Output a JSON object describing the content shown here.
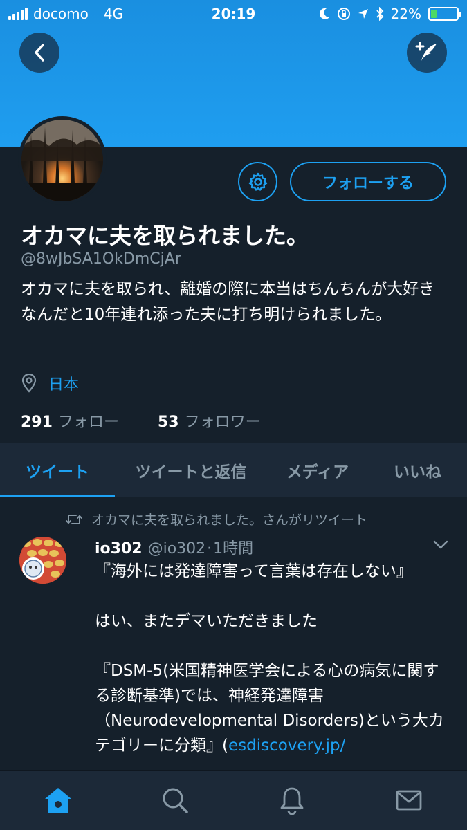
{
  "status_bar": {
    "carrier": "docomo",
    "network": "4G",
    "time": "20:19",
    "battery_percent": "22%",
    "battery_level": 0.22,
    "icons": [
      "moon-icon",
      "rotation-lock-icon",
      "location-arrow-icon",
      "bluetooth-icon",
      "battery-icon"
    ]
  },
  "header": {
    "back_icon": "chevron-left-icon",
    "compose_icon": "compose-tweet-icon",
    "banner_color": "#1da1f2"
  },
  "profile": {
    "display_name": "オカマに夫を取られました。",
    "handle": "@8wJbSA1OkDmCjAr",
    "bio": "オカマに夫を取られ、離婚の際に本当はちんちんが大好きなんだと10年連れ添った夫に打ち明けられました。",
    "location": "日本",
    "following_count": "291",
    "following_label": "フォロー",
    "followers_count": "53",
    "followers_label": "フォロワー",
    "follow_button_label": "フォローする",
    "settings_icon": "gear-icon"
  },
  "tabs": [
    {
      "label": "ツイート",
      "active": true
    },
    {
      "label": "ツイートと返信",
      "active": false
    },
    {
      "label": "メディア",
      "active": false
    },
    {
      "label": "いいね",
      "active": false
    }
  ],
  "tweet": {
    "retweet_text": "オカマに夫を取られました。さんがリツイート",
    "author_name": "io302",
    "author_handle": "@io302",
    "separator": "·",
    "time_ago": "1時間",
    "body_text": "『海外には発達障害って言葉は存在しない』\n\nはい、またデマいただきました\n\n『DSM-5(米国精神医学会による心の病気に関する診断基準)では、神経発達障害（Neurodevelopmental Disorders)という大カテゴリーに分類』(",
    "body_link": "esdiscovery.jp/"
  },
  "bottom_nav": [
    {
      "name": "home",
      "icon": "home-icon",
      "active": true
    },
    {
      "name": "search",
      "icon": "search-icon",
      "active": false
    },
    {
      "name": "notifications",
      "icon": "bell-icon",
      "active": false
    },
    {
      "name": "messages",
      "icon": "mail-icon",
      "active": false
    }
  ],
  "colors": {
    "accent": "#1da1f2",
    "background": "#15202b",
    "secondary_text": "#8899a6",
    "panel": "#1c2938"
  }
}
